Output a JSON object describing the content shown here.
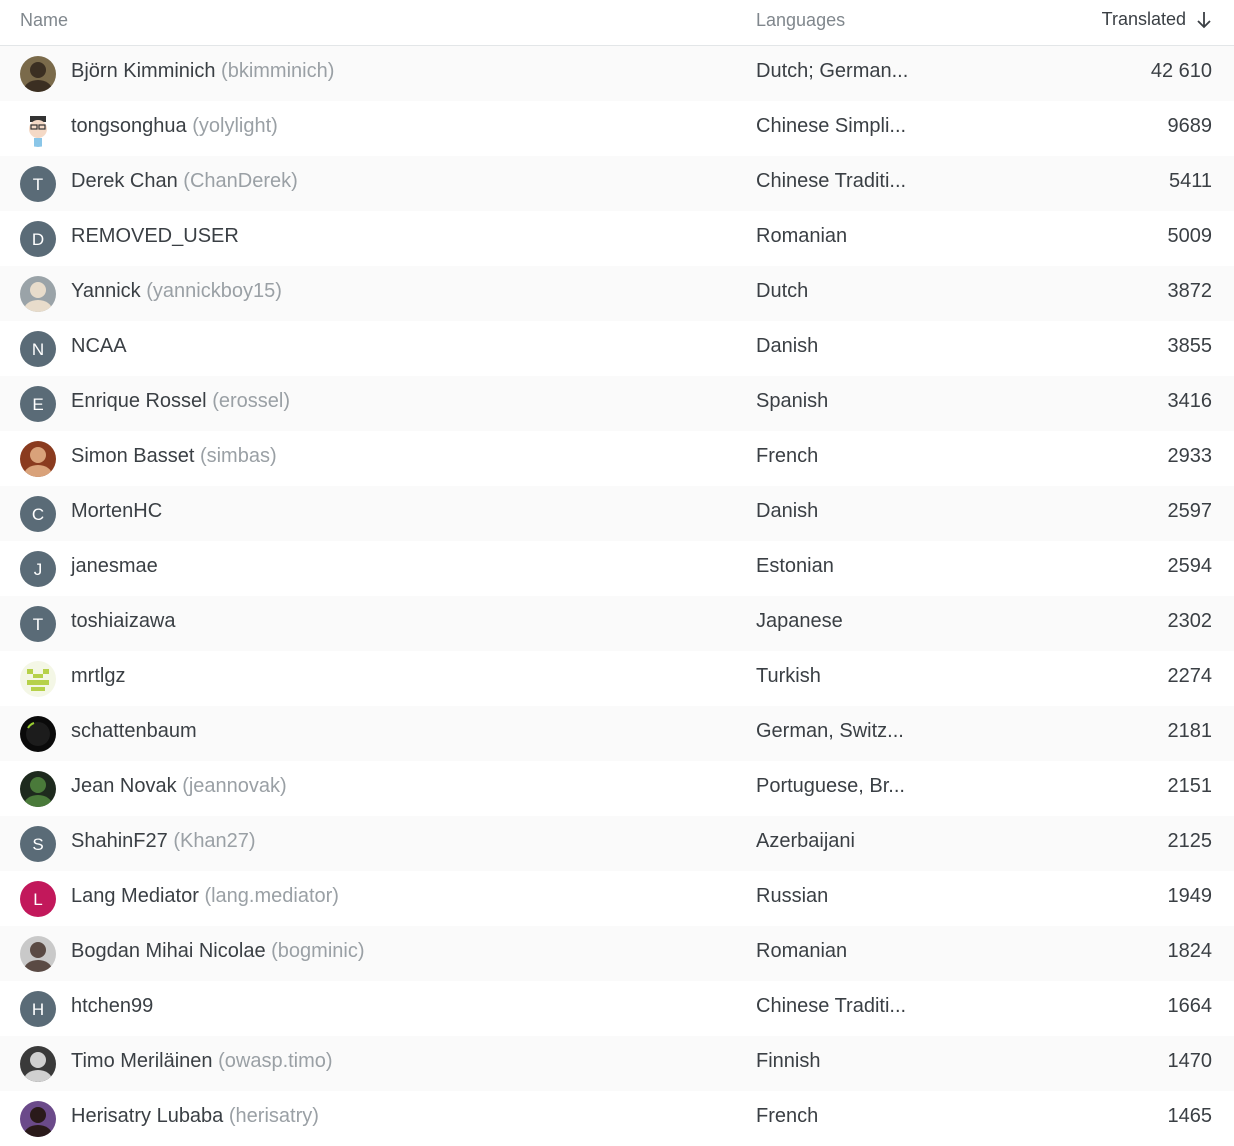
{
  "header": {
    "name": "Name",
    "languages": "Languages",
    "translated": "Translated",
    "sort_icon": "arrow-down-icon"
  },
  "colors": {
    "letter_avatar": "#5a6b77",
    "pink_avatar": "#c2185b",
    "username": "#9aa0a5",
    "text": "#3a3f44",
    "zebra": "#fafafa"
  },
  "rows": [
    {
      "display": "Björn Kimminich",
      "username": "(bkimminich)",
      "languages": "Dutch; German...",
      "count": "42 610",
      "avatar": {
        "type": "photo",
        "bg": "#7a6a4a",
        "fg": "#3b2f22"
      }
    },
    {
      "display": "tongsonghua",
      "username": "(yolylight)",
      "languages": "Chinese Simpli...",
      "count": "9689",
      "avatar": {
        "type": "cartoon",
        "bg": "#ffffff",
        "fg": "#333333"
      }
    },
    {
      "display": "Derek Chan",
      "username": "(ChanDerek)",
      "languages": "Chinese Traditi...",
      "count": "5411",
      "avatar": {
        "type": "letter",
        "letter": "T",
        "bg": "#5a6b77"
      }
    },
    {
      "display": "REMOVED_USER",
      "username": "",
      "languages": "Romanian",
      "count": "5009",
      "avatar": {
        "type": "letter",
        "letter": "D",
        "bg": "#5a6b77"
      }
    },
    {
      "display": "Yannick",
      "username": "(yannickboy15)",
      "languages": "Dutch",
      "count": "3872",
      "avatar": {
        "type": "photo",
        "bg": "#9aa3a8",
        "fg": "#e8dccb"
      }
    },
    {
      "display": "NCAA",
      "username": "",
      "languages": "Danish",
      "count": "3855",
      "avatar": {
        "type": "letter",
        "letter": "N",
        "bg": "#5a6b77"
      }
    },
    {
      "display": "Enrique Rossel",
      "username": "(erossel)",
      "languages": "Spanish",
      "count": "3416",
      "avatar": {
        "type": "letter",
        "letter": "E",
        "bg": "#5a6b77"
      }
    },
    {
      "display": "Simon Basset",
      "username": "(simbas)",
      "languages": "French",
      "count": "2933",
      "avatar": {
        "type": "photo",
        "bg": "#8a3b1f",
        "fg": "#d9a27a"
      }
    },
    {
      "display": "MortenHC",
      "username": "",
      "languages": "Danish",
      "count": "2597",
      "avatar": {
        "type": "letter",
        "letter": "C",
        "bg": "#5a6b77"
      }
    },
    {
      "display": "janesmae",
      "username": "",
      "languages": "Estonian",
      "count": "2594",
      "avatar": {
        "type": "letter",
        "letter": "J",
        "bg": "#5a6b77"
      }
    },
    {
      "display": "toshiaizawa",
      "username": "",
      "languages": "Japanese",
      "count": "2302",
      "avatar": {
        "type": "letter",
        "letter": "T",
        "bg": "#5a6b77"
      }
    },
    {
      "display": "mrtlgz",
      "username": "",
      "languages": "Turkish",
      "count": "2274",
      "avatar": {
        "type": "identicon",
        "bg": "#f4f7e6",
        "fg": "#b6d14a"
      }
    },
    {
      "display": "schattenbaum",
      "username": "",
      "languages": "German, Switz...",
      "count": "2181",
      "avatar": {
        "type": "dark",
        "bg": "#0a0a0a",
        "fg": "#9acd32"
      }
    },
    {
      "display": "Jean Novak",
      "username": "(jeannovak)",
      "languages": "Portuguese, Br...",
      "count": "2151",
      "avatar": {
        "type": "photo",
        "bg": "#1e2a1e",
        "fg": "#4a7a3a"
      }
    },
    {
      "display": "ShahinF27",
      "username": "(Khan27)",
      "languages": "Azerbaijani",
      "count": "2125",
      "avatar": {
        "type": "letter",
        "letter": "S",
        "bg": "#5a6b77"
      }
    },
    {
      "display": "Lang Mediator",
      "username": "(lang.mediator)",
      "languages": "Russian",
      "count": "1949",
      "avatar": {
        "type": "letter",
        "letter": "L",
        "bg": "#c2185b"
      }
    },
    {
      "display": "Bogdan Mihai Nicolae",
      "username": "(bogminic)",
      "languages": "Romanian",
      "count": "1824",
      "avatar": {
        "type": "photo",
        "bg": "#c9c9c9",
        "fg": "#5a4a44"
      }
    },
    {
      "display": "htchen99",
      "username": "",
      "languages": "Chinese Traditi...",
      "count": "1664",
      "avatar": {
        "type": "letter",
        "letter": "H",
        "bg": "#5a6b77"
      }
    },
    {
      "display": "Timo Meriläinen",
      "username": "(owasp.timo)",
      "languages": "Finnish",
      "count": "1470",
      "avatar": {
        "type": "photo",
        "bg": "#3a3a3a",
        "fg": "#d0d0d0"
      }
    },
    {
      "display": "Herisatry Lubaba",
      "username": "(herisatry)",
      "languages": "French",
      "count": "1465",
      "avatar": {
        "type": "photo",
        "bg": "#6b4a8a",
        "fg": "#2a1a1a"
      }
    }
  ]
}
